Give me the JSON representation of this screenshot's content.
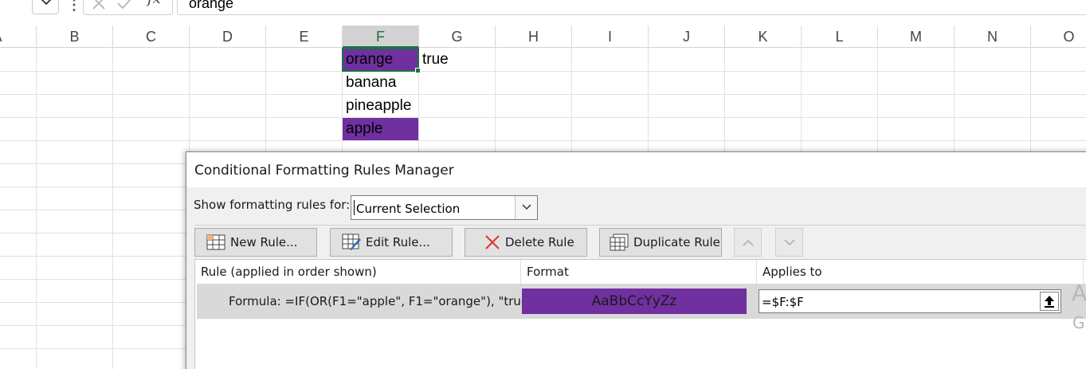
{
  "formula_bar": {
    "fx_label": "fx",
    "content": "orange"
  },
  "grid": {
    "columns": [
      "A",
      "B",
      "C",
      "D",
      "E",
      "F",
      "G",
      "H",
      "I",
      "J",
      "K",
      "L",
      "M",
      "N",
      "O"
    ],
    "selected_column": "F",
    "cells": {
      "F1": "orange",
      "G1": "true",
      "F2": "banana",
      "F3": "pineapple",
      "F4": "apple"
    },
    "highlight_color": "#7030a0",
    "selection_color": "#1e7145"
  },
  "dialog": {
    "title": "Conditional Formatting Rules Manager",
    "show_label": "Show formatting rules for:",
    "show_value": "Current Selection",
    "buttons": {
      "new_rule": "New Rule...",
      "edit_rule": "Edit Rule...",
      "delete_rule": "Delete Rule",
      "duplicate_rule": "Duplicate Rule"
    },
    "columns": {
      "rule": "Rule (applied in order shown)",
      "format": "Format",
      "applies_to": "Applies to"
    },
    "rules": [
      {
        "rule": "Formula: =IF(OR(F1=\"apple\", F1=\"orange\"), \"true...",
        "format_preview": "AaBbCcYyZz",
        "format_color": "#7030a0",
        "applies_to": "=$F:$F"
      }
    ],
    "clipped_right": [
      "A",
      "G"
    ]
  }
}
